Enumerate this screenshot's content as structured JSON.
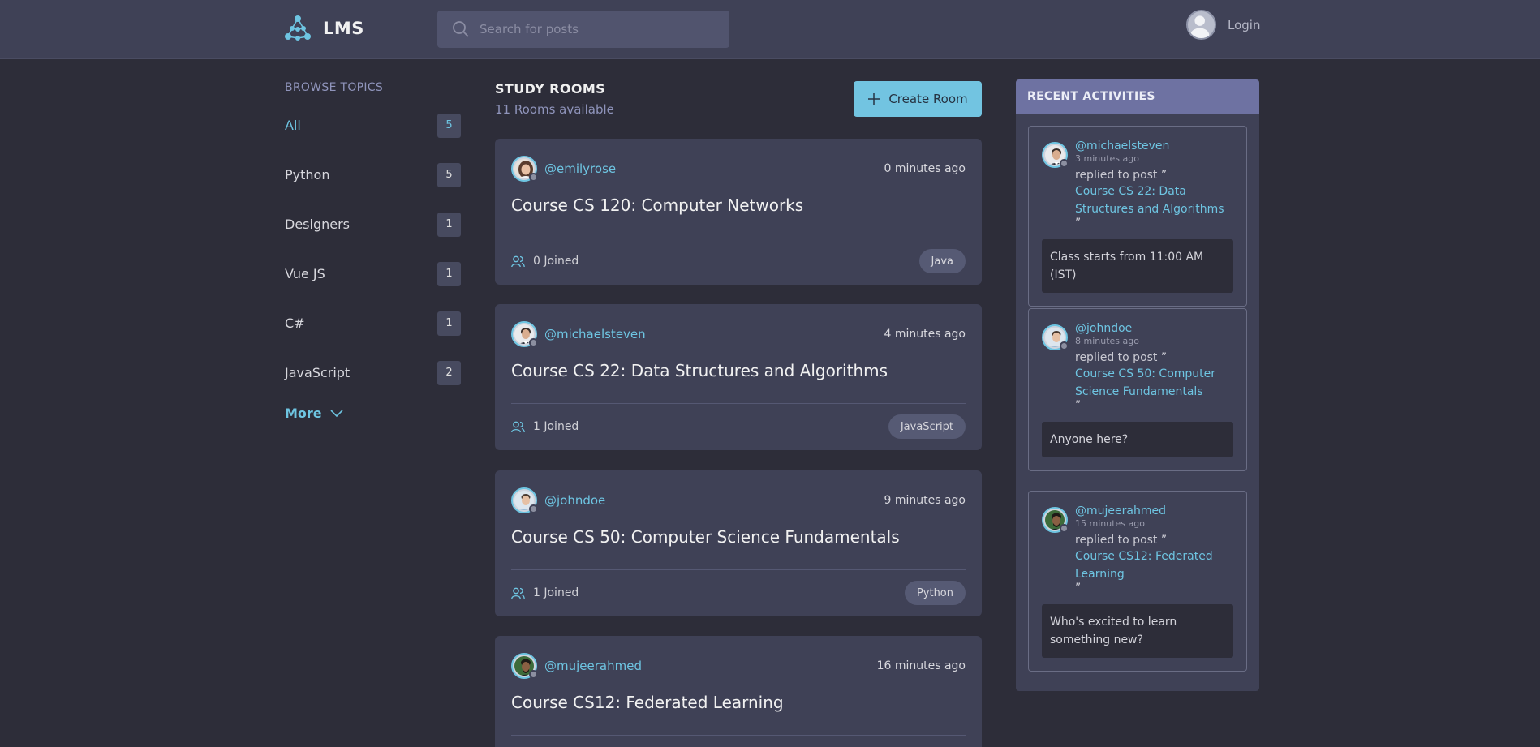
{
  "app": {
    "name": "LMS"
  },
  "search": {
    "placeholder": "Search for posts"
  },
  "header": {
    "login_label": "Login"
  },
  "sidebar": {
    "title": "BROWSE TOPICS",
    "topics": [
      {
        "label": "All",
        "count": "5"
      },
      {
        "label": "Python",
        "count": "5"
      },
      {
        "label": "Designers",
        "count": "1"
      },
      {
        "label": "Vue JS",
        "count": "1"
      },
      {
        "label": "C#",
        "count": "1"
      },
      {
        "label": "JavaScript",
        "count": "2"
      }
    ],
    "more_label": "More"
  },
  "main": {
    "title": "STUDY ROOMS",
    "subtitle": "11 Rooms available",
    "create_label": "Create Room",
    "rooms": [
      {
        "host": "@emilyrose",
        "time": "0 minutes ago",
        "title": "Course CS 120: Computer Networks",
        "joined": "0 Joined",
        "tag": "Java"
      },
      {
        "host": "@michaelsteven",
        "time": "4 minutes ago",
        "title": "Course CS 22: Data Structures and Algorithms",
        "joined": "1 Joined",
        "tag": "JavaScript"
      },
      {
        "host": "@johndoe",
        "time": "9 minutes ago",
        "title": "Course CS 50: Computer Science Fundamentals",
        "joined": "1 Joined",
        "tag": "Python"
      },
      {
        "host": "@mujeerahmed",
        "time": "16 minutes ago",
        "title": "Course CS12: Federated Learning",
        "joined": "",
        "tag": ""
      }
    ]
  },
  "activity": {
    "title": "RECENT ACTIVITIES",
    "items": [
      {
        "user": "@michaelsteven",
        "time": "3 minutes ago",
        "action": "replied to post ”",
        "link_line1": "Course CS 22: Data",
        "link_line2": "Structures and Algorithms",
        "quote": "”",
        "message": "Class starts from 11:00 AM (IST)"
      },
      {
        "user": "@johndoe",
        "time": "8 minutes ago",
        "action": "replied to post ”",
        "link_line1": "Course CS 50: Computer",
        "link_line2": "Science Fundamentals",
        "quote": "”",
        "message": "Anyone here?"
      },
      {
        "user": "@mujeerahmed",
        "time": "15 minutes ago",
        "action": "replied to post ”",
        "link_line1": "Course CS12: Federated",
        "link_line2": "Learning",
        "quote": "”",
        "message": "Who's excited to learn something new?"
      }
    ]
  },
  "colors": {
    "accent": "#6ec5e2",
    "background": "#2d2d39",
    "card": "#3f4156",
    "activity_header": "#6e72a2"
  },
  "icons": [
    "lms-logo-icon",
    "search-icon",
    "user-avatar-icon",
    "chevron-down-icon",
    "plus-icon",
    "users-icon"
  ]
}
